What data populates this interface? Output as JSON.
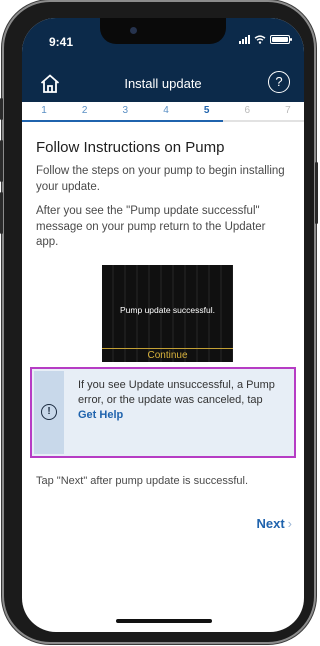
{
  "status_bar": {
    "time": "9:41"
  },
  "header": {
    "title": "Install update",
    "home_icon": "home-icon",
    "help_icon": "help-icon",
    "help_glyph": "?"
  },
  "steps": {
    "items": [
      "1",
      "2",
      "3",
      "4",
      "5",
      "6",
      "7"
    ],
    "current": 5,
    "progress_fraction": 0.714
  },
  "content": {
    "heading": "Follow Instructions on Pump",
    "paragraph1": "Follow the steps on your pump to begin installing your update.",
    "paragraph2": "After you see the \"Pump update successful\" message on your pump return to the Updater app.",
    "pump_display": {
      "message": "Pump update successful.",
      "button": "Continue"
    }
  },
  "alert": {
    "icon": "alert-icon",
    "glyph": "!",
    "text": "If you see Update unsuccessful, a Pump error, or the update was canceled, tap",
    "link": "Get Help"
  },
  "footer": {
    "instruction": "Tap \"Next\" after pump update is successful.",
    "next_label": "Next",
    "next_chevron": "›"
  },
  "colors": {
    "header_bg": "#0c2a4a",
    "accent": "#1f63ad",
    "alert_border": "#b63cc4",
    "alert_bg": "#e7eef6"
  }
}
